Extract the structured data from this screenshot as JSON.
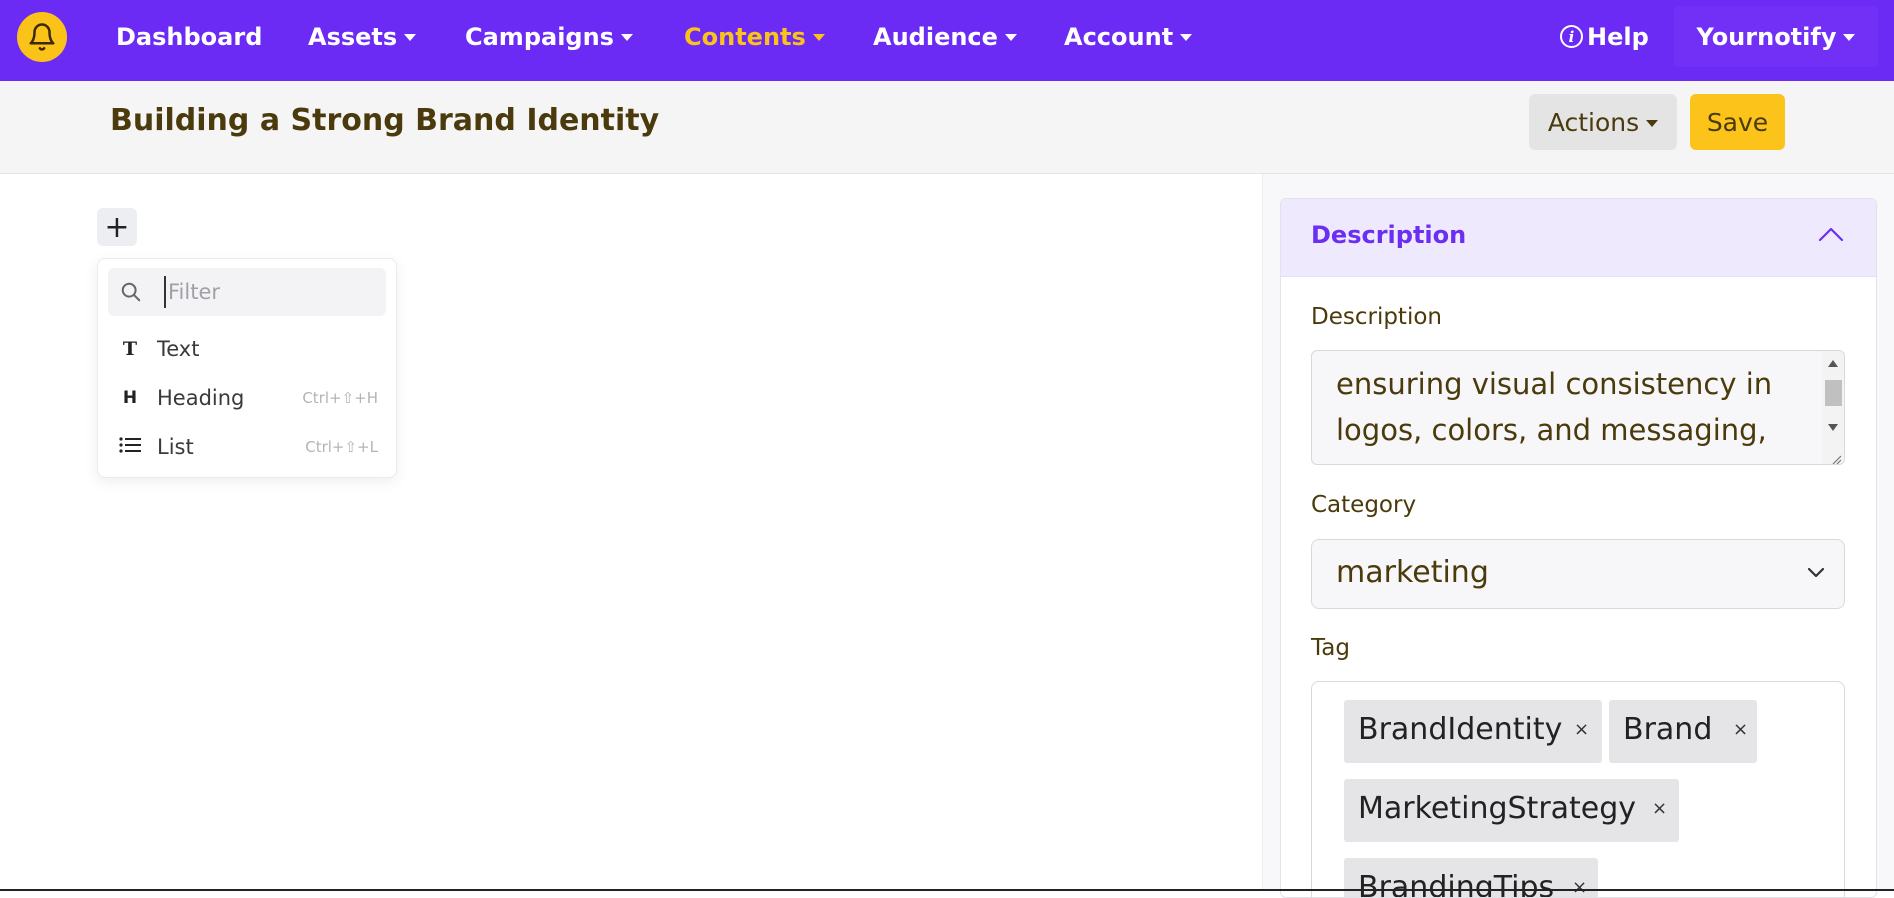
{
  "nav": {
    "items": [
      {
        "label": "Dashboard"
      },
      {
        "label": "Assets"
      },
      {
        "label": "Campaigns"
      },
      {
        "label": "Contents"
      },
      {
        "label": "Audience"
      },
      {
        "label": "Account"
      }
    ],
    "help_label": "Help",
    "user_label": "Yournotify",
    "active_color": "#fbc21a",
    "bar_color": "#6c2bf5"
  },
  "header": {
    "title": "Building a Strong Brand Identity",
    "actions_label": "Actions",
    "save_label": "Save"
  },
  "editor": {
    "add_block_label": "+",
    "filter_placeholder": "Filter",
    "block_types": [
      {
        "icon": "T",
        "label": "Text",
        "shortcut": ""
      },
      {
        "icon": "H",
        "label": "Heading",
        "shortcut": "Ctrl+⇧+H"
      },
      {
        "icon": "list-icon",
        "label": "List",
        "shortcut": "Ctrl+⇧+L"
      }
    ]
  },
  "panel": {
    "title": "Description",
    "description_label": "Description",
    "description_lines": [
      "ensuring visual consistency in",
      "logos, colors, and messaging,"
    ],
    "category_label": "Category",
    "category_value": "marketing",
    "tag_label": "Tag",
    "tags": [
      {
        "label": "BrandIdentity"
      },
      {
        "label": "Brand"
      },
      {
        "label": "MarketingStrategy"
      },
      {
        "label": "BrandingTips"
      }
    ],
    "remove_symbol": "×"
  }
}
